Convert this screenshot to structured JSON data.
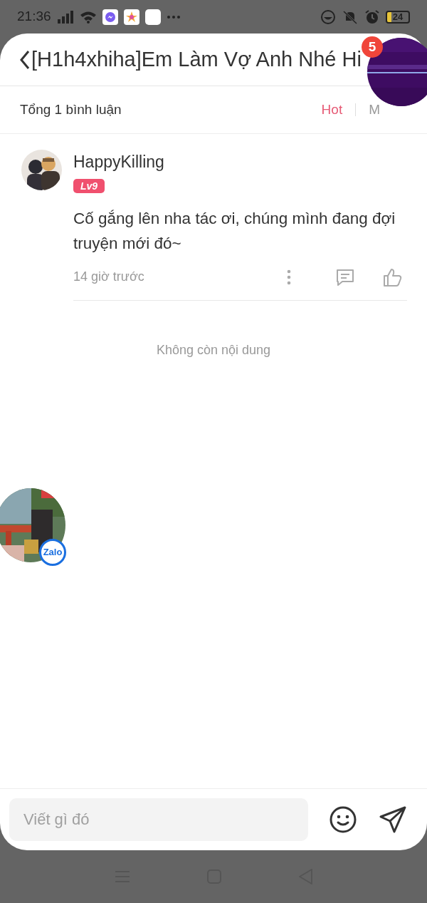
{
  "status_bar": {
    "time": "21:36",
    "battery": "24"
  },
  "header": {
    "title": "[H1h4xhiha]Em Làm Vợ Anh Nhé Hi"
  },
  "comment_bar": {
    "total": "Tổng 1 bình luận",
    "sort_tabs": [
      {
        "label": "Hot",
        "selected": true
      },
      {
        "label": "M",
        "selected": false
      }
    ]
  },
  "comments": [
    {
      "user": "HappyKilling",
      "level": "Lv9",
      "text": "Cố gắng lên nha tác ơi, chúng mình đang đợi truyện mới đó~",
      "time": "14 giờ trước"
    }
  ],
  "end_note": "Không còn nội dung",
  "input": {
    "placeholder": "Viết gì đó"
  },
  "floating_bubbles": [
    {
      "kind": "notification",
      "badge": "5"
    },
    {
      "kind": "zalo",
      "label": "Zalo"
    }
  ]
}
